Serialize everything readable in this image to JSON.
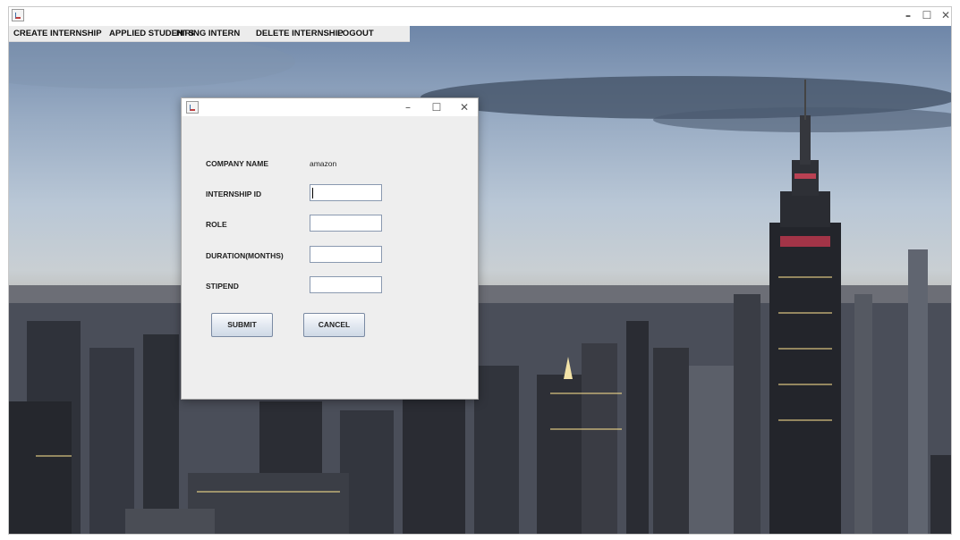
{
  "main_window": {
    "title": "",
    "controls": {
      "minimize": "–",
      "maximize": "☐",
      "close": "✕"
    },
    "menu": [
      "CREATE INTERNSHIP",
      "APPLIED STUDENTS",
      "HIRING INTERN",
      "DELETE INTERNSHIP",
      "LOGOUT"
    ]
  },
  "dialog": {
    "title": "",
    "controls": {
      "minimize": "–",
      "maximize": "☐",
      "close": "✕"
    },
    "fields": [
      {
        "label": "COMPANY NAME",
        "value": "amazon",
        "type": "static"
      },
      {
        "label": "INTERNSHIP ID",
        "value": "",
        "type": "input"
      },
      {
        "label": "ROLE",
        "value": "",
        "type": "input"
      },
      {
        "label": "DURATION(MONTHS)",
        "value": "",
        "type": "input"
      },
      {
        "label": "STIPEND",
        "value": "",
        "type": "input"
      }
    ],
    "buttons": {
      "submit": "SUBMIT",
      "cancel": "CANCEL"
    }
  },
  "colors": {
    "window_bg": "#eeeeee",
    "button_border": "#7a8aa3",
    "input_border": "#8a99b0"
  }
}
